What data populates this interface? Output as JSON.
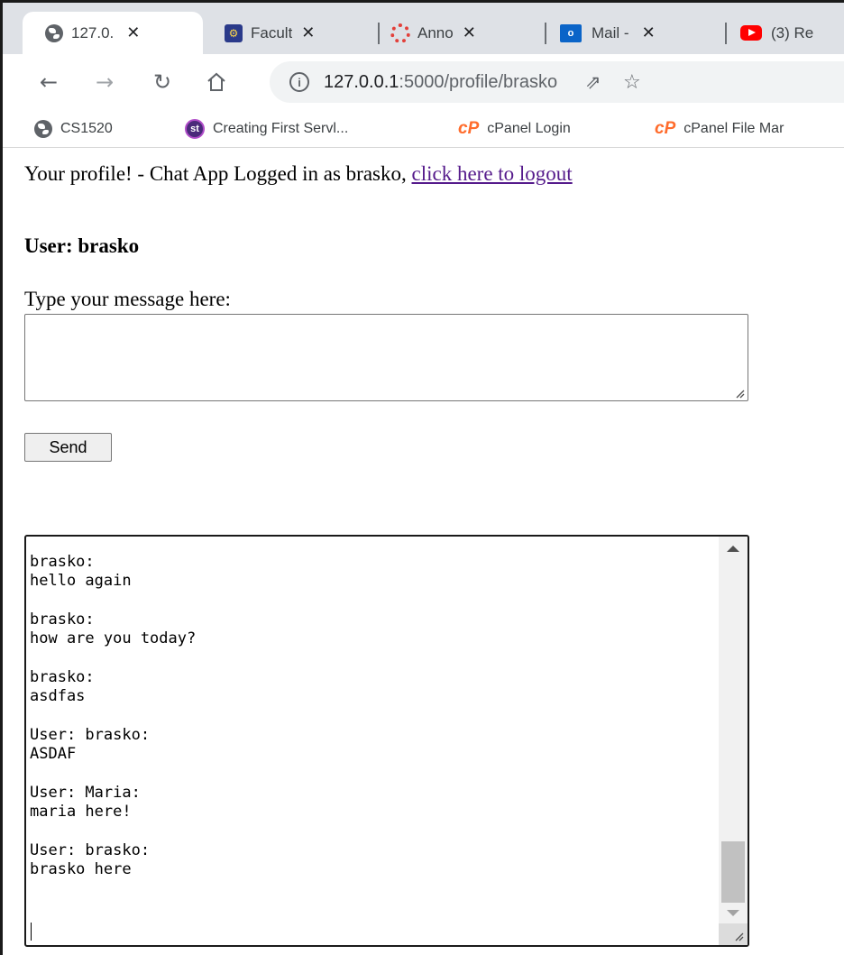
{
  "browser": {
    "tabs": [
      {
        "title": "127.0.",
        "icon": "globe-icon"
      },
      {
        "title": "Facult",
        "icon": "university-icon"
      },
      {
        "title": "Anno",
        "icon": "canvas-icon"
      },
      {
        "title": "Mail -",
        "icon": "outlook-icon"
      },
      {
        "title": "(3) Re",
        "icon": "youtube-icon"
      }
    ],
    "close_glyph": "✕",
    "address": {
      "host": "127.0.0.1",
      "path": ":5000/profile/brasko"
    },
    "bookmarks": [
      {
        "label": "CS1520",
        "icon": "globe-icon"
      },
      {
        "label": "Creating First Servl...",
        "icon": "st-icon"
      },
      {
        "label": "cPanel Login",
        "icon": "cpanel-icon"
      },
      {
        "label": "cPanel File Mar",
        "icon": "cpanel-icon"
      }
    ]
  },
  "page": {
    "header_text": "Your profile! - Chat App Logged in as brasko, ",
    "logout_link": "click here to logout",
    "user_heading": "User: brasko",
    "message_label": "Type your message here:",
    "message_value": "",
    "send_label": "Send",
    "chat_messages": [
      {
        "author": "brasko:",
        "text": "hello again"
      },
      {
        "author": "brasko:",
        "text": "how are you today?"
      },
      {
        "author": "brasko:",
        "text": "asdfas"
      },
      {
        "author": "User: brasko:",
        "text": "ASDAF"
      },
      {
        "author": "User: Maria:",
        "text": "maria here!"
      },
      {
        "author": "User: brasko:",
        "text": "brasko here"
      }
    ]
  }
}
